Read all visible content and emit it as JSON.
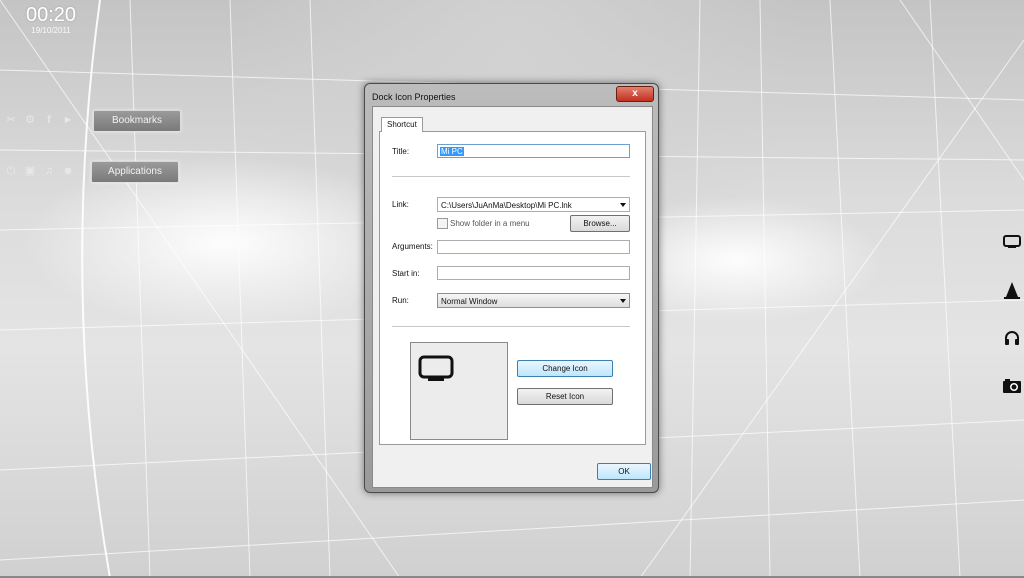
{
  "desktop": {
    "clock": {
      "time": "00:20",
      "date": "19/10/2011"
    },
    "bookmarks_label": "Bookmarks",
    "applications_label": "Applications",
    "bookmark_icons": [
      "scissors-icon",
      "gear-icon",
      "facebook-icon",
      "youtube-icon"
    ],
    "application_icons": [
      "power-icon",
      "image-icon",
      "music-icon",
      "people-icon"
    ],
    "right_dock_icons": [
      "monitor-icon",
      "cone-icon",
      "headphones-icon",
      "camera-icon"
    ]
  },
  "dialog": {
    "title": "Dock Icon Properties",
    "close_label": "x",
    "tab_label": "Shortcut",
    "title_label": "Title:",
    "title_value": "Mi PC",
    "link_label": "Link:",
    "link_value": "C:\\Users\\JuAnMa\\Desktop\\Mi PC.lnk",
    "show_folder_label": "Show folder in a menu",
    "browse_label": "Browse...",
    "arguments_label": "Arguments:",
    "arguments_value": "",
    "start_in_label": "Start in:",
    "start_in_value": "",
    "run_label": "Run:",
    "run_value": "Normal Window",
    "change_icon_label": "Change Icon",
    "reset_icon_label": "Reset Icon",
    "ok_label": "OK",
    "preview_icon": "monitor-icon"
  }
}
